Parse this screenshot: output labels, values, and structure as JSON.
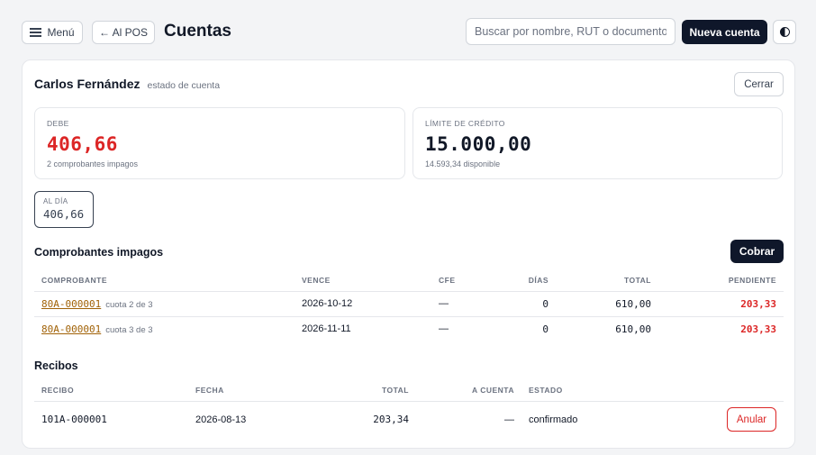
{
  "header": {
    "menu_label": "Menú",
    "back_label": "← Al POS",
    "title": "Cuentas",
    "search_placeholder": "Buscar por nombre, RUT o documento",
    "new_account_label": "Nueva cuenta",
    "theme_icon": "contrast-icon"
  },
  "customer": {
    "name": "Carlos Fernández",
    "subtitle": "estado de cuenta",
    "close_label": "Cerrar"
  },
  "stats": {
    "debe": {
      "label": "DEBE",
      "value": "406,66",
      "note": "2 comprobantes impagos"
    },
    "limite": {
      "label": "LÍMITE DE CRÉDITO",
      "value": "15.000,00",
      "note": "14.593,34 disponible"
    }
  },
  "aging": {
    "label": "AL DÍA",
    "value": "406,66"
  },
  "unpaid": {
    "title": "Comprobantes impagos",
    "action_label": "Cobrar",
    "columns": [
      "COMPROBANTE",
      "VENCE",
      "CFE",
      "DÍAS",
      "TOTAL",
      "PENDIENTE"
    ],
    "rows": [
      {
        "doc": "80A-000001",
        "cuota": "cuota 2 de 3",
        "vence": "2026-10-12",
        "cfe": "—",
        "dias": "0",
        "total": "610,00",
        "pendiente": "203,33"
      },
      {
        "doc": "80A-000001",
        "cuota": "cuota 3 de 3",
        "vence": "2026-11-11",
        "cfe": "—",
        "dias": "0",
        "total": "610,00",
        "pendiente": "203,33"
      }
    ]
  },
  "receipts": {
    "title": "Recibos",
    "columns": [
      "RECIBO",
      "FECHA",
      "TOTAL",
      "A CUENTA",
      "ESTADO"
    ],
    "rows": [
      {
        "recibo": "101A-000001",
        "fecha": "2026-08-13",
        "total": "203,34",
        "a_cuenta": "—",
        "estado": "confirmado",
        "action_label": "Anular"
      }
    ]
  },
  "colors": {
    "primary": "#0f172a",
    "danger": "#dc2626",
    "link": "#a16207"
  }
}
